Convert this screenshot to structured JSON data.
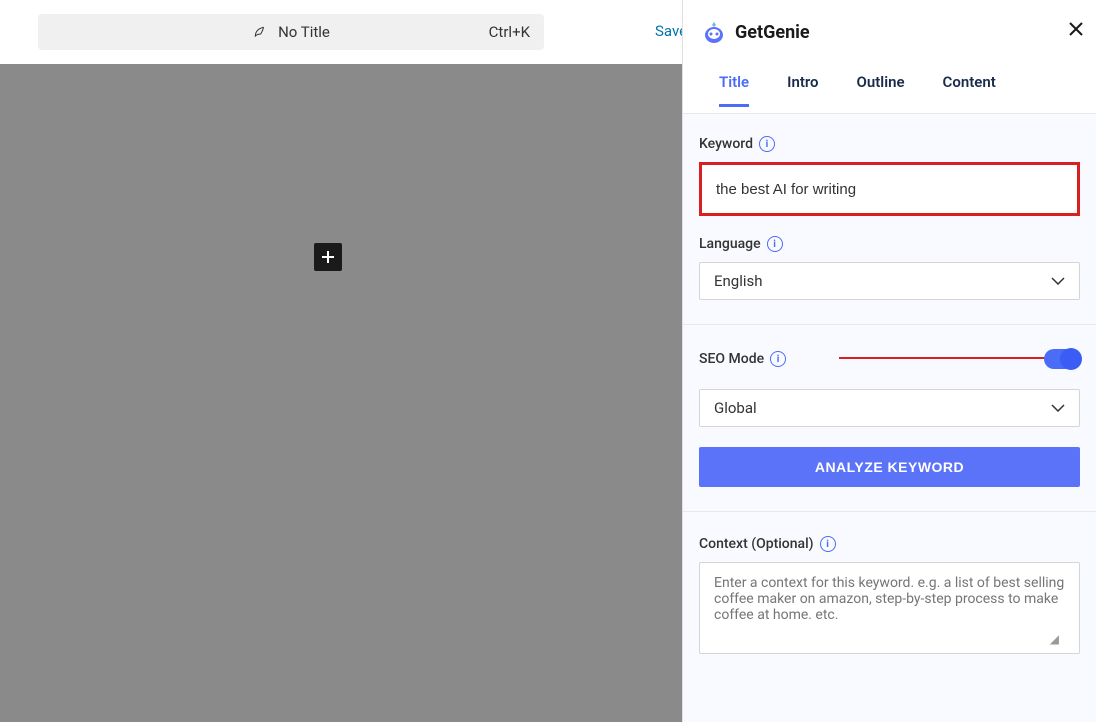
{
  "titleBar": {
    "title": "No Title",
    "shortcut": "Ctrl+K"
  },
  "saveLink": "Save",
  "brand": "GetGenie",
  "tabs": {
    "title": "Title",
    "intro": "Intro",
    "outline": "Outline",
    "content": "Content"
  },
  "keyword": {
    "label": "Keyword",
    "value": "the best AI for writing"
  },
  "language": {
    "label": "Language",
    "value": "English"
  },
  "seoMode": {
    "label": "SEO Mode",
    "region": "Global"
  },
  "analyzeButton": "ANALYZE KEYWORD",
  "context": {
    "label": "Context (Optional)",
    "placeholder": "Enter a context for this keyword. e.g. a list of best selling coffee maker on amazon, step-by-step process to make coffee at home. etc."
  }
}
